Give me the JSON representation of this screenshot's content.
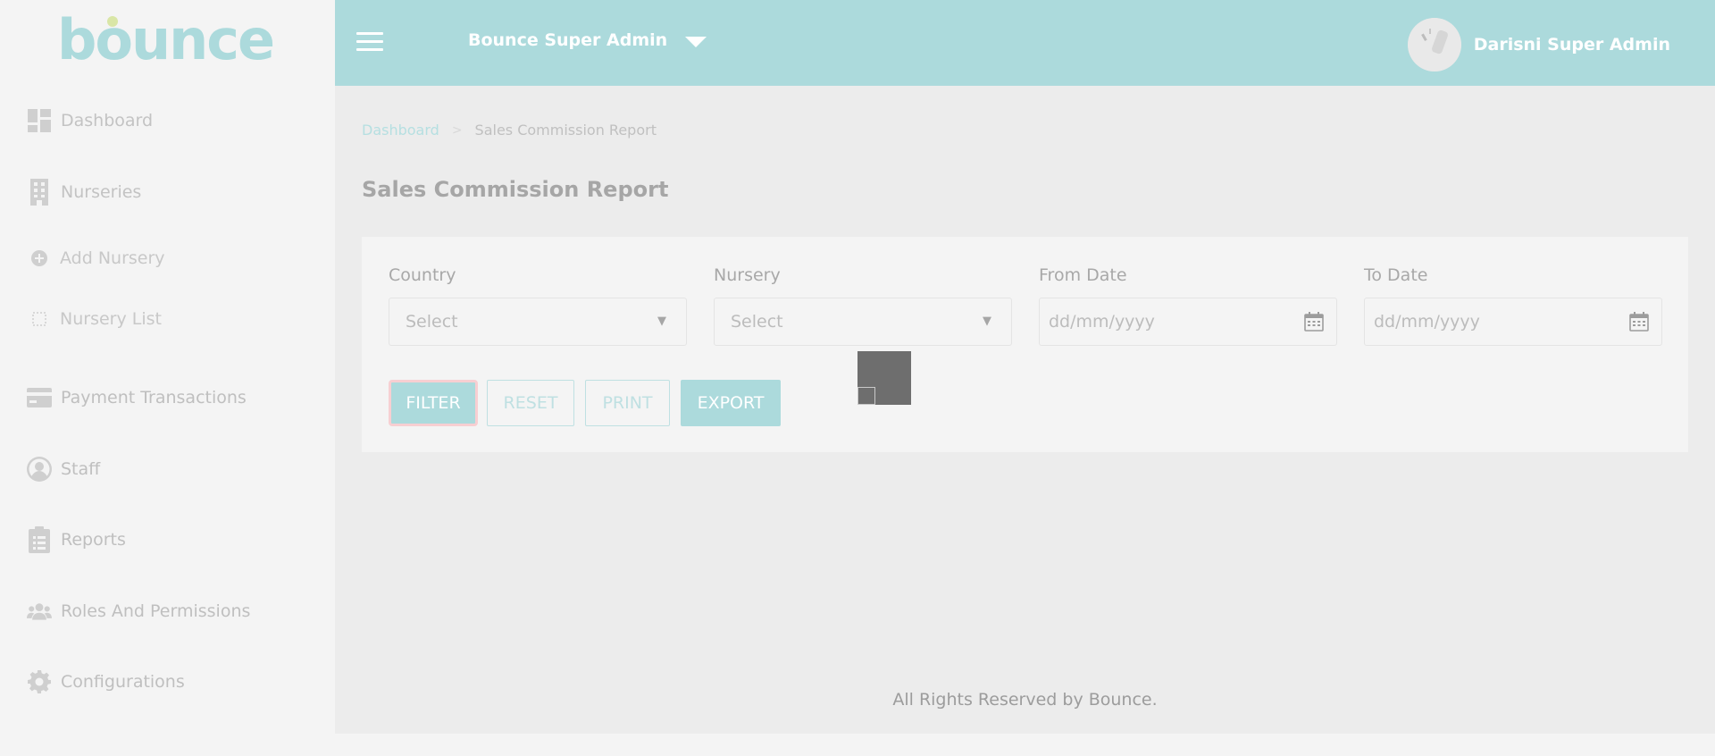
{
  "brand": {
    "logo_text": "bounce"
  },
  "sidebar": {
    "items": [
      {
        "label": "Dashboard",
        "icon": "dashboard-icon"
      },
      {
        "label": "Nurseries",
        "icon": "building-icon"
      },
      {
        "label": "Add Nursery",
        "icon": "plus-circle-icon"
      },
      {
        "label": "Nursery List",
        "icon": "dotted-square-icon"
      },
      {
        "label": "Payment Transactions",
        "icon": "credit-card-icon"
      },
      {
        "label": "Staff",
        "icon": "user-circle-icon"
      },
      {
        "label": "Reports",
        "icon": "clipboard-icon"
      },
      {
        "label": "Roles And Permissions",
        "icon": "users-icon"
      },
      {
        "label": "Configurations",
        "icon": "gear-icon"
      }
    ]
  },
  "header": {
    "org_name": "Bounce Super Admin",
    "user_name": "Darisni Super Admin"
  },
  "breadcrumb": {
    "root": "Dashboard",
    "current": "Sales Commission Report"
  },
  "page": {
    "title": "Sales Commission Report"
  },
  "filters": {
    "country": {
      "label": "Country",
      "value": "Select"
    },
    "nursery": {
      "label": "Nursery",
      "value": "Select"
    },
    "from_date": {
      "label": "From Date",
      "placeholder": "dd/mm/yyyy"
    },
    "to_date": {
      "label": "To Date",
      "placeholder": "dd/mm/yyyy"
    }
  },
  "actions": {
    "filter": "FILTER",
    "reset": "RESET",
    "print": "PRINT",
    "export": "EXPORT"
  },
  "footer": {
    "text": "All Rights Reserved by Bounce."
  },
  "colors": {
    "accent": "#acdadc",
    "sidebar_bg": "#f4f4f4",
    "main_bg": "#ececec",
    "loader": "#6e6e6e"
  }
}
